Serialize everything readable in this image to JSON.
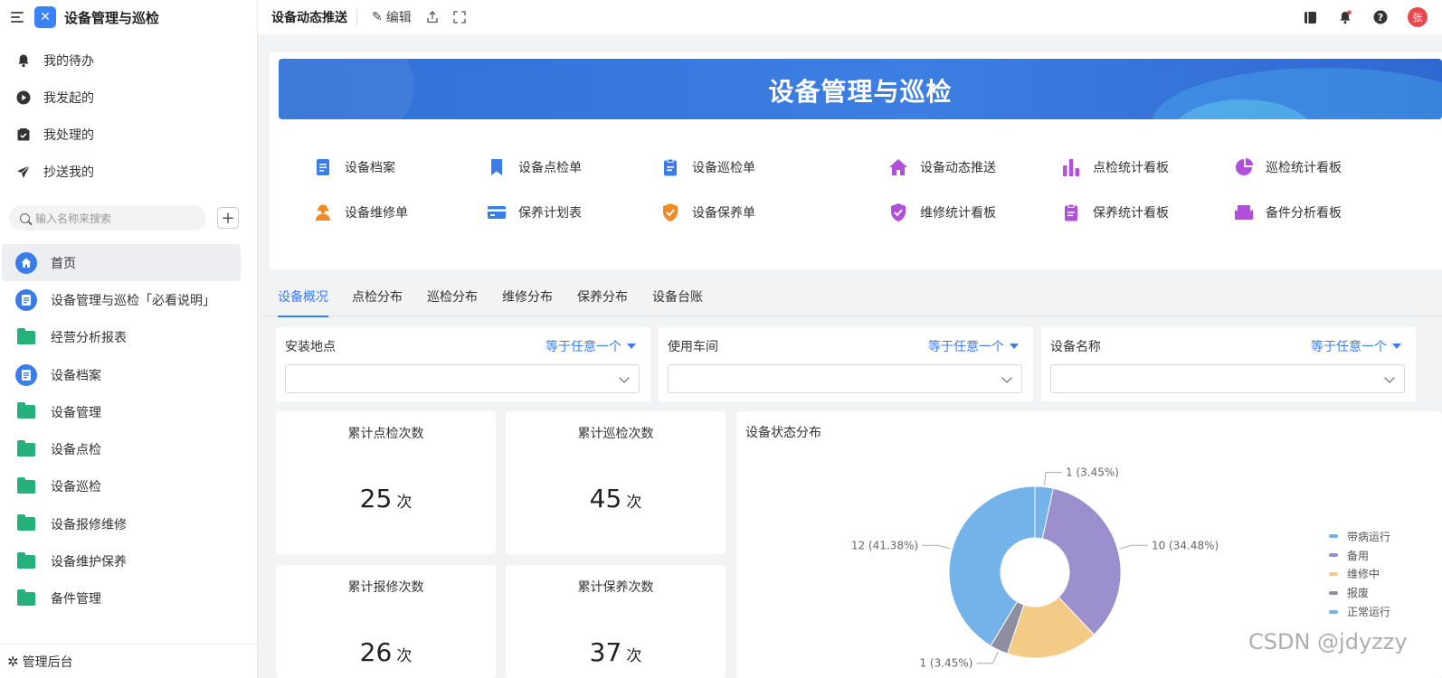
{
  "app": {
    "title": "设备管理与巡检"
  },
  "quick": [
    {
      "label": "我的待办",
      "icon": "bell-icon"
    },
    {
      "label": "我发起的",
      "icon": "play-icon"
    },
    {
      "label": "我处理的",
      "icon": "check-box-icon"
    },
    {
      "label": "抄送我的",
      "icon": "send-icon"
    }
  ],
  "search": {
    "placeholder": "输入名称来搜索"
  },
  "tree": [
    {
      "label": "首页",
      "icon": "home-icon"
    },
    {
      "label": "设备管理与巡检「必看说明」",
      "icon": "form-icon"
    },
    {
      "label": "经营分析报表",
      "icon": "folder-icon"
    },
    {
      "label": "设备档案",
      "icon": "form-icon"
    },
    {
      "label": "设备管理",
      "icon": "folder-icon"
    },
    {
      "label": "设备点检",
      "icon": "folder-icon"
    },
    {
      "label": "设备巡检",
      "icon": "folder-icon"
    },
    {
      "label": "设备报修维修",
      "icon": "folder-icon"
    },
    {
      "label": "设备维护保养",
      "icon": "folder-icon"
    },
    {
      "label": "备件管理",
      "icon": "folder-icon"
    }
  ],
  "footer": {
    "label": "管理后台"
  },
  "topbar": {
    "title": "设备动态推送",
    "edit": "编辑"
  },
  "banner": {
    "title": "设备管理与巡检"
  },
  "nav": [
    {
      "label": "设备档案",
      "icon": "document-icon",
      "color": "#3b7de8"
    },
    {
      "label": "设备点检单",
      "icon": "bookmark-icon",
      "color": "#3b7de8"
    },
    {
      "label": "设备巡检单",
      "icon": "clipboard-icon",
      "color": "#3b7de8"
    },
    {
      "label": "设备动态推送",
      "icon": "home-icon",
      "color": "#b04fd9"
    },
    {
      "label": "点检统计看板",
      "icon": "bar-chart-icon",
      "color": "#b04fd9"
    },
    {
      "label": "巡检统计看板",
      "icon": "pie-chart-icon",
      "color": "#b04fd9"
    },
    {
      "label": "设备维修单",
      "icon": "worker-icon",
      "color": "#f08a24"
    },
    {
      "label": "保养计划表",
      "icon": "card-icon",
      "color": "#3b7de8"
    },
    {
      "label": "设备保养单",
      "icon": "shield-check-icon",
      "color": "#f08a24"
    },
    {
      "label": "维修统计看板",
      "icon": "shield-check-icon",
      "color": "#b04fd9"
    },
    {
      "label": "保养统计看板",
      "icon": "clipboard-icon",
      "color": "#b04fd9"
    },
    {
      "label": "备件分析看板",
      "icon": "envelope-icon",
      "color": "#b04fd9"
    }
  ],
  "tabs": [
    "设备概况",
    "点检分布",
    "巡检分布",
    "维修分布",
    "保养分布",
    "设备台账"
  ],
  "filters": [
    {
      "label": "安装地点",
      "op": "等于任意一个"
    },
    {
      "label": "使用车间",
      "op": "等于任意一个"
    },
    {
      "label": "设备名称",
      "op": "等于任意一个"
    }
  ],
  "stats": [
    {
      "title": "累计点检次数",
      "value": "25",
      "unit": "次"
    },
    {
      "title": "累计巡检次数",
      "value": "45",
      "unit": "次"
    },
    {
      "title": "累计报修次数",
      "value": "26",
      "unit": "次"
    },
    {
      "title": "累计保养次数",
      "value": "37",
      "unit": "次"
    }
  ],
  "chart_data": {
    "type": "pie",
    "title": "设备状态分布",
    "slices": [
      {
        "name": "带病运行",
        "value": 1,
        "label": "1 (3.45%)",
        "color": "#74b2ea"
      },
      {
        "name": "备用",
        "value": 10,
        "label": "10 (34.48%)",
        "color": "#9b8fce"
      },
      {
        "name": "维修中",
        "value": 5,
        "label": "",
        "color": "#f3cb87"
      },
      {
        "name": "报废",
        "value": 1,
        "label": "1 (3.45%)",
        "color": "#8e8ea0"
      },
      {
        "name": "正常运行",
        "value": 12,
        "label": "12 (41.38%)",
        "color": "#74b2ea"
      }
    ],
    "legend_position": "right"
  },
  "watermark": "CSDN @jdyzzy"
}
